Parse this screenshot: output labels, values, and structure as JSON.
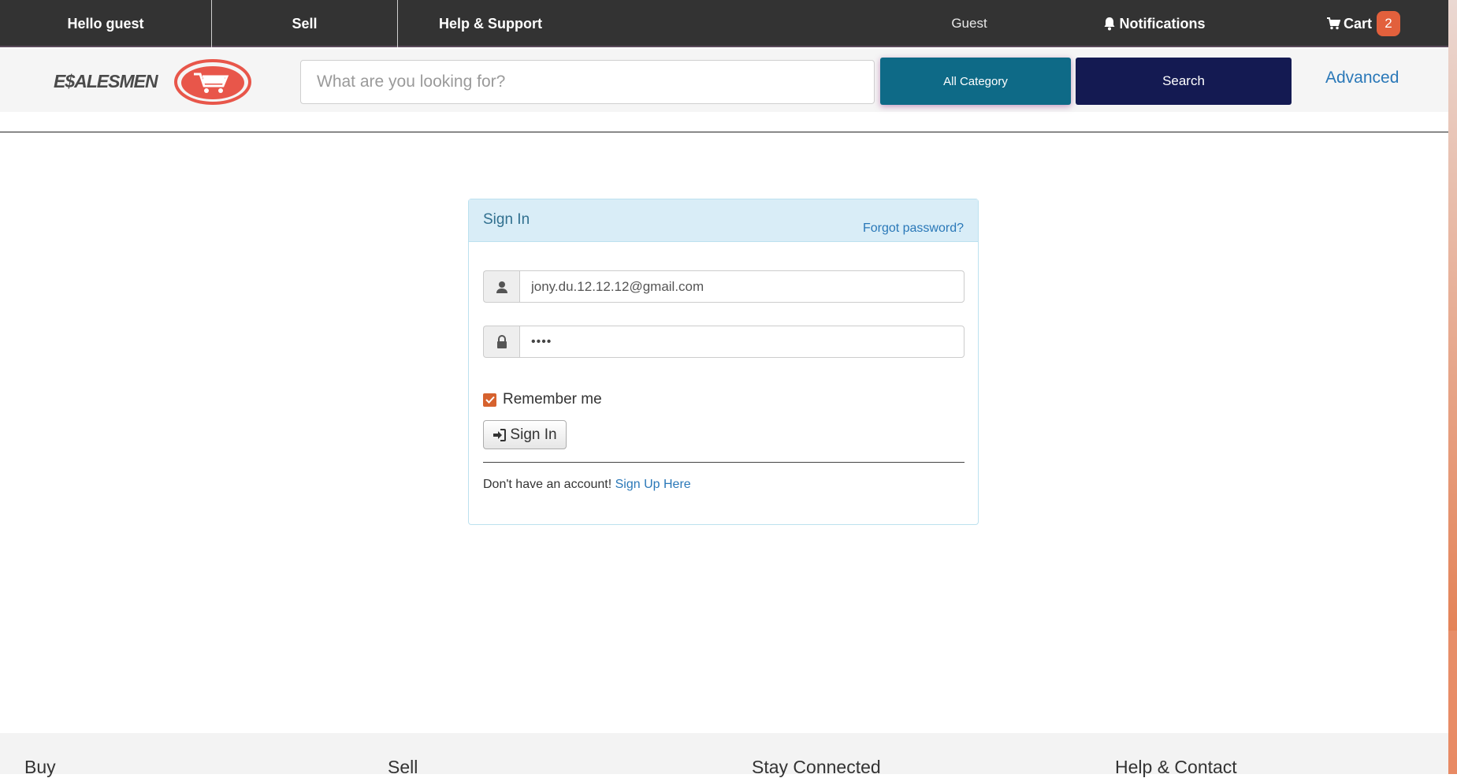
{
  "topbar": {
    "greeting": "Hello guest",
    "sell": "Sell",
    "help": "Help & Support",
    "user": "Guest",
    "notifications": "Notifications",
    "cart_label": "Cart",
    "cart_count": "2"
  },
  "header": {
    "logo_text": "E$ALESMEN",
    "search_placeholder": "What are you looking for?",
    "category_button": "All Category",
    "search_button": "Search",
    "advanced_link": "Advanced"
  },
  "signin": {
    "title": "Sign In",
    "forgot_link": "Forgot password?",
    "email_value": "jony.du.12.12.12@gmail.com",
    "password_value": "••••",
    "remember_label": "Remember me",
    "remember_checked": true,
    "submit_label": "Sign In",
    "no_account_text": "Don't have an account!",
    "signup_link": "Sign Up Here"
  },
  "footer": {
    "columns": [
      "Buy",
      "Sell",
      "Stay Connected",
      "Help & Contact"
    ]
  },
  "colors": {
    "topbar_bg": "#333333",
    "category_btn": "#0e6a87",
    "search_btn": "#141a52",
    "link": "#2a78b8",
    "panel_head": "#d9edf7",
    "accent_orange": "#e2603c"
  },
  "icons": {
    "notifications": "bell-icon",
    "cart": "cart-icon",
    "user": "user-icon",
    "password": "lock-icon",
    "sign_in": "sign-in-icon",
    "checkbox": "check-icon"
  }
}
